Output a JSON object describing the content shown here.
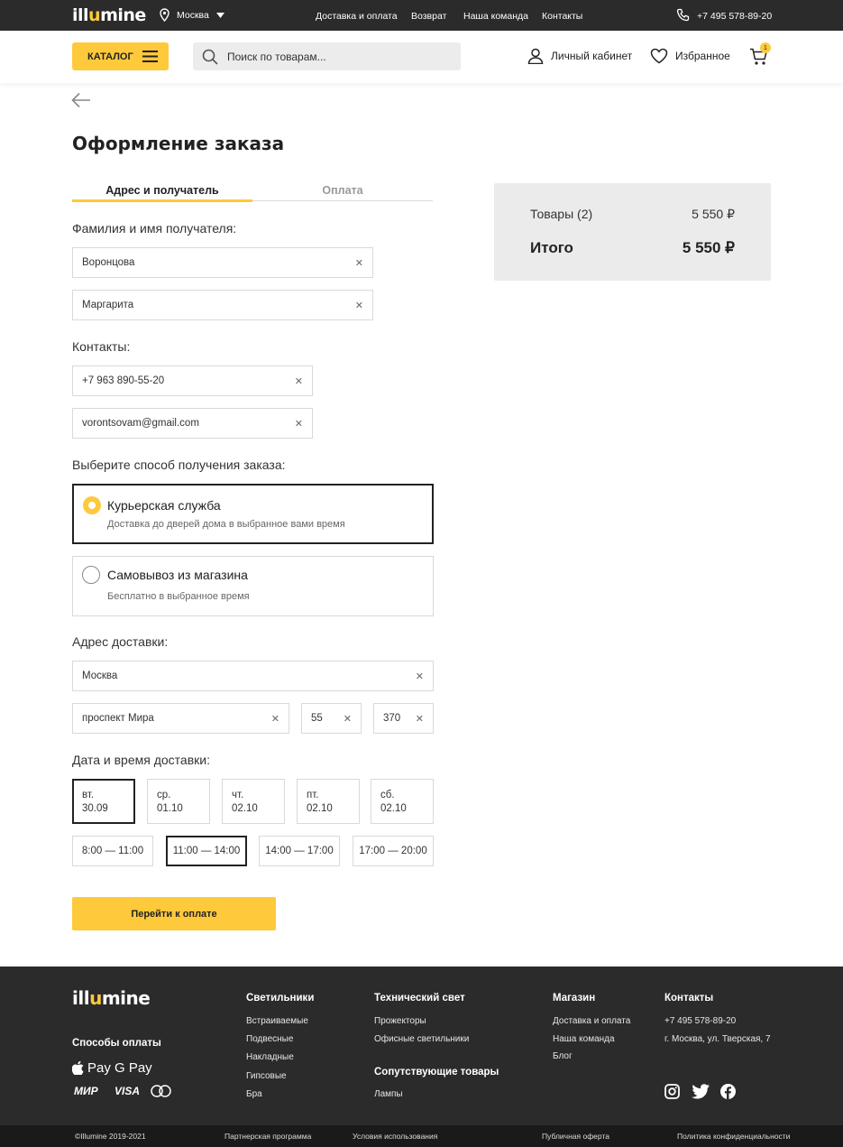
{
  "topbar": {
    "logo_pre": "ill",
    "logo_u": "u",
    "logo_post": "mine",
    "city": "Москва",
    "nav": [
      "Доставка и оплата",
      "Возврат",
      "Наша команда",
      "Контакты"
    ],
    "phone": "+7 495 578-89-20"
  },
  "header": {
    "catalog_label": "КАТАЛОГ",
    "search_placeholder": "Поиск по товарам...",
    "account_label": "Личный кабинет",
    "favorites_label": "Избранное",
    "cart_count": "1"
  },
  "page": {
    "title": "Оформление заказа",
    "tabs": [
      "Адрес и получатель",
      "Оплата"
    ]
  },
  "form": {
    "recipient_label": "Фамилия и имя получателя:",
    "last_name": "Воронцова",
    "first_name": "Маргарита",
    "contacts_label": "Контакты:",
    "phone": "+7 963 890-55-20",
    "email": "vorontsovam@gmail.com",
    "delivery_method_label": "Выберите способ получения заказа:",
    "options": [
      {
        "title": "Курьерская служба",
        "subtitle": "Доставка до дверей дома в выбранное вами время",
        "selected": true
      },
      {
        "title": "Самовывоз из магазина",
        "subtitle": "Бесплатно в выбранное время",
        "selected": false
      }
    ],
    "address_label": "Адрес доставки:",
    "city": "Москва",
    "street": "проспект Мира",
    "house": "55",
    "apartment": "370",
    "datetime_label": "Дата и время доставки:",
    "days": [
      {
        "dow": "вт.",
        "date": "30.09"
      },
      {
        "dow": "ср.",
        "date": "01.10"
      },
      {
        "dow": "чт.",
        "date": "02.10"
      },
      {
        "dow": "пт.",
        "date": "02.10"
      },
      {
        "dow": "сб.",
        "date": "02.10"
      }
    ],
    "selected_day": "30.09",
    "slots": [
      "8:00 — 11:00",
      "11:00 — 14:00",
      "14:00 — 17:00",
      "17:00 — 20:00"
    ],
    "selected_slot": "11:00 — 14:00",
    "submit_label": "Перейти к оплате"
  },
  "summary": {
    "items_label": "Товары (2)",
    "items_value": "5 550 ₽",
    "total_label": "Итого",
    "total_value": "5 550 ₽"
  },
  "footer": {
    "payment_title": "Способы оплаты",
    "pay_icons": [
      "Pay",
      "G Pay",
      "МИР",
      "VISA"
    ],
    "col1_title": "Светильники",
    "col1": [
      "Встраиваемые",
      "Подвесные",
      "Накладные",
      "Гипсовые",
      "Бра"
    ],
    "col2_title": "Технический свет",
    "col2": [
      "Прожекторы",
      "Офисные светильники"
    ],
    "col3_title": "Сопутствующие товары",
    "col3": [
      "Лампы"
    ],
    "col4_title": "Магазин",
    "col4": [
      "Доставка и оплата",
      "Наша команда",
      "Блог"
    ],
    "col5_title": "Контакты",
    "col5": [
      "+7 495 578-89-20",
      "г. Москва, ул. Тверская, 7"
    ],
    "bottom": [
      "©Illumine 2019-2021",
      "Партнерская программа",
      "Условия использования",
      "Публичная оферта",
      "Политика конфиденциальности"
    ]
  },
  "colors": {
    "accent": "#ffc93c",
    "dark": "#2b2b2b",
    "summary_bg": "#ebebeb"
  }
}
